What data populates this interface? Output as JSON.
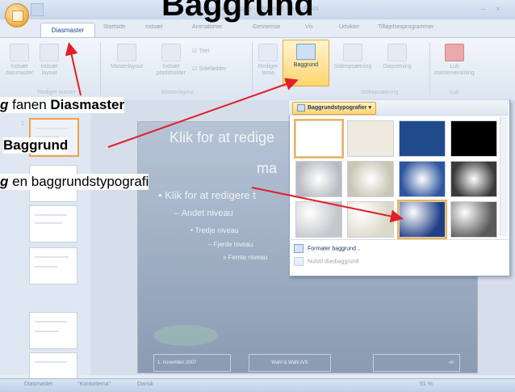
{
  "heading": {
    "text": "Baggrund"
  },
  "window": {
    "title": "Præsentation5.pptx - Microsoft PowerPoint",
    "controls": [
      "–",
      "×"
    ]
  },
  "tabs": {
    "active": "Diasmaster",
    "items": [
      "Startside",
      "Indsæt",
      "Animationer",
      "Gennemse",
      "Vis",
      "Udvikler",
      "Tilføjelsesprogrammer"
    ]
  },
  "ribbon": {
    "buttons": [
      {
        "label": "Indsæt diasmaster"
      },
      {
        "label": "Indsæt layout"
      },
      {
        "label": "Masterlayout"
      },
      {
        "label": "Indsæt pladsholder"
      },
      {
        "label": "Titel"
      },
      {
        "label": "Sidefødder"
      },
      {
        "label": "Rediger tema"
      },
      {
        "label": "Baggrund"
      },
      {
        "label": "Sideopsætning"
      },
      {
        "label": "Diasretning"
      },
      {
        "label": "Luk masterversining"
      }
    ],
    "groups": [
      "Rediger master",
      "Masterlayout",
      "Sideopsætning",
      "Luk"
    ]
  },
  "slide": {
    "title": "Klik for at redige",
    "title_line2": "ma",
    "level1": "• Klik for at redigere t",
    "level2": "– Andet niveau",
    "level3": "• Tredje niveau",
    "level4": "– Fjerde niveau",
    "level5": "» Femte niveau",
    "footer_date": "1. november 2007",
    "footer_center": "Wahl & Wahl A/S",
    "footer_num": "‹#›"
  },
  "panel": {
    "header": "Baggrundstypografier",
    "format_label": "Formater baggrund...",
    "reset_label": "Nulstil diasbaggrund",
    "swatches": [
      "#ffffff",
      "#eeeae0",
      "#1f4a8c",
      "#000000",
      "#b8bcc2",
      "#c9c6b4",
      "#2e56a0",
      "#3a3a3a",
      "#c4c6ca",
      "#dcd9c8",
      "#213f86",
      "#5a5a5a"
    ]
  },
  "callouts": {
    "line1_italic": "g",
    "line1_mid": " fanen ",
    "line1_bold": "Diasmaster",
    "line2_bold": "Baggrund",
    "line3_italic": "g",
    "line3_rest": " en baggrundstypografi"
  },
  "statusbar": {
    "mode": "Diasmaster",
    "theme": "\"Kontortema\"",
    "language": "Dansk",
    "zoom": "51 %"
  },
  "colors": {
    "arrow": "#e0202a",
    "highlight": "#ffd36c"
  }
}
